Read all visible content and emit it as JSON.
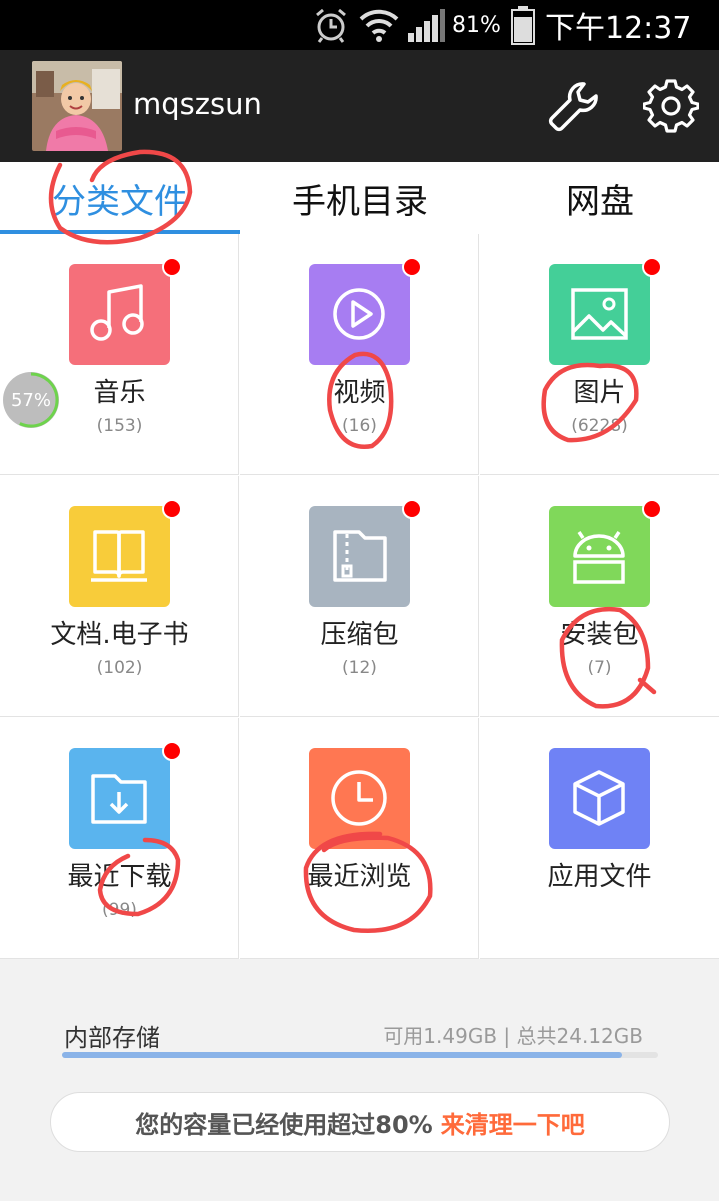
{
  "status_bar": {
    "time": "下午12:37",
    "battery_percent": "81%",
    "icons": [
      "alarm-icon",
      "wifi-icon",
      "signal-icon",
      "battery-icon"
    ]
  },
  "header": {
    "username": "mqszsun",
    "icons": [
      "wrench-icon",
      "gear-icon"
    ]
  },
  "tabs": [
    {
      "label": "分类文件",
      "active": true
    },
    {
      "label": "手机目录",
      "active": false
    },
    {
      "label": "网盘",
      "active": false
    }
  ],
  "categories": [
    {
      "label": "音乐",
      "count": "(153)",
      "color": "#f56f7a",
      "icon": "music-icon",
      "badge": true
    },
    {
      "label": "视频",
      "count": "(16)",
      "color": "#a77df2",
      "icon": "play-icon",
      "badge": true
    },
    {
      "label": "图片",
      "count": "(6228)",
      "color": "#44cf98",
      "icon": "image-icon",
      "badge": true
    },
    {
      "label": "文档.电子书",
      "count": "(102)",
      "color": "#f8cc3a",
      "icon": "book-icon",
      "badge": true
    },
    {
      "label": "压缩包",
      "count": "(12)",
      "color": "#a8b4c0",
      "icon": "zip-folder-icon",
      "badge": true
    },
    {
      "label": "安装包",
      "count": "(7)",
      "color": "#80d85a",
      "icon": "android-icon",
      "badge": true
    },
    {
      "label": "最近下载",
      "count": "(99)",
      "color": "#5ab4ee",
      "icon": "download-folder-icon",
      "badge": true
    },
    {
      "label": "最近浏览",
      "count": "",
      "color": "#ff7752",
      "icon": "clock-icon",
      "badge": false
    },
    {
      "label": "应用文件",
      "count": "",
      "color": "#6f82f5",
      "icon": "cube-icon",
      "badge": false
    }
  ],
  "memory_widget": {
    "percent": "57%",
    "level": 0.57
  },
  "storage": {
    "label": "内部存储",
    "detail": "可用1.49GB | 总共24.12GB",
    "used_fraction": 0.94
  },
  "cleanup": {
    "text": "您的容量已经使用超过80%",
    "action": "来清理一下吧"
  }
}
